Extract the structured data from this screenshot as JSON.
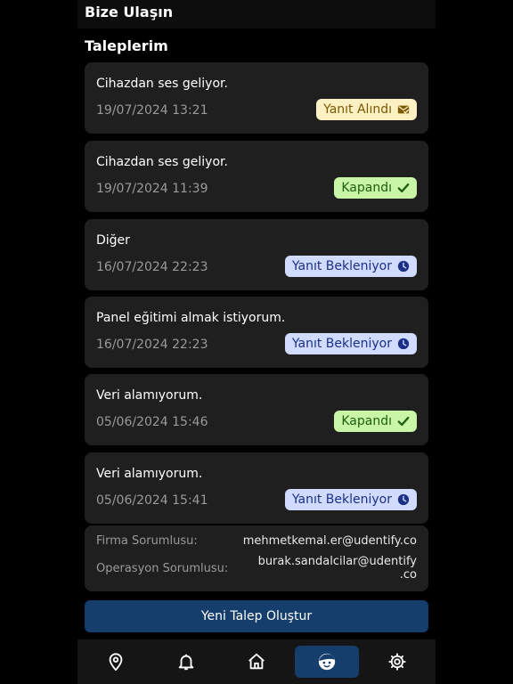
{
  "header": {
    "title": "Bize Ulaşın"
  },
  "requests_section": {
    "title": "Taleplerim"
  },
  "requests": [
    {
      "subject": "Cihazdan ses geliyor.",
      "date": "19/07/2024 13:21",
      "status": "Yanıt Alındı",
      "status_icon": "mail-check-icon"
    },
    {
      "subject": "Cihazdan ses geliyor.",
      "date": "19/07/2024 11:39",
      "status": "Kapandı",
      "status_icon": "check-icon"
    },
    {
      "subject": "Diğer",
      "date": "16/07/2024 22:23",
      "status": "Yanıt Bekleniyor",
      "status_icon": "clock-icon"
    },
    {
      "subject": "Panel eğitimi almak istiyorum.",
      "date": "16/07/2024 22:23",
      "status": "Yanıt Bekleniyor",
      "status_icon": "clock-icon"
    },
    {
      "subject": "Veri alamıyorum.",
      "date": "05/06/2024 15:46",
      "status": "Kapandı",
      "status_icon": "check-icon"
    },
    {
      "subject": "Veri alamıyorum.",
      "date": "05/06/2024 15:41",
      "status": "Yanıt Bekleniyor",
      "status_icon": "clock-icon"
    }
  ],
  "contacts": {
    "company_label": "Firma Sorumlusu:",
    "company_email": "mehmetkemal.er@udentify.co",
    "operations_label": "Operasyon Sorumlusu:",
    "operations_email_line1": "burak.sandalcilar@udentify",
    "operations_email_line2": ".co"
  },
  "new_request_button": "Yeni Talep Oluştur",
  "bottom_nav": [
    {
      "icon": "location-pin-icon",
      "active": false
    },
    {
      "icon": "bell-icon",
      "active": false
    },
    {
      "icon": "home-icon",
      "active": false
    },
    {
      "icon": "support-face-icon",
      "active": true
    },
    {
      "icon": "gear-icon",
      "active": false
    }
  ],
  "colors": {
    "accent": "#163e6c",
    "card": "#1f1f1f",
    "status_received_bg": "#fdf0c3",
    "status_closed_bg": "#c9f5a6",
    "status_waiting_bg": "#d0dbff"
  }
}
